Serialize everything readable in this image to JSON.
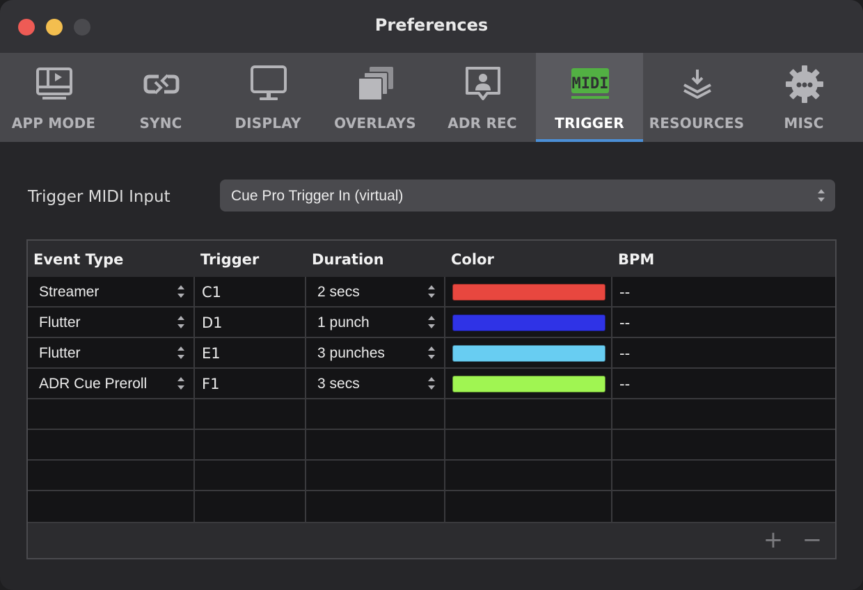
{
  "window": {
    "title": "Preferences"
  },
  "toolbar": {
    "tabs": [
      {
        "label": "APP MODE",
        "icon": "app-mode-icon",
        "active": false
      },
      {
        "label": "SYNC",
        "icon": "sync-icon",
        "active": false
      },
      {
        "label": "DISPLAY",
        "icon": "display-icon",
        "active": false
      },
      {
        "label": "OVERLAYS",
        "icon": "overlays-icon",
        "active": false
      },
      {
        "label": "ADR REC",
        "icon": "adr-rec-icon",
        "active": false
      },
      {
        "label": "TRIGGER",
        "icon": "midi-icon",
        "active": true
      },
      {
        "label": "RESOURCES",
        "icon": "resources-icon",
        "active": false
      },
      {
        "label": "MISC",
        "icon": "gear-icon",
        "active": false
      }
    ],
    "midi_icon_text": "MIDI"
  },
  "trigger_input": {
    "label": "Trigger MIDI Input",
    "value": "Cue Pro Trigger In (virtual)"
  },
  "table": {
    "columns": [
      "Event Type",
      "Trigger",
      "Duration",
      "Color",
      "BPM"
    ],
    "rows": [
      {
        "event_type": "Streamer",
        "trigger": "C1",
        "duration": "2 secs",
        "color": "#e8473f",
        "bpm": "--"
      },
      {
        "event_type": "Flutter",
        "trigger": "D1",
        "duration": "1 punch",
        "color": "#2f33e6",
        "bpm": "--"
      },
      {
        "event_type": "Flutter",
        "trigger": "E1",
        "duration": "3 punches",
        "color": "#68cdf2",
        "bpm": "--"
      },
      {
        "event_type": "ADR Cue Preroll",
        "trigger": "F1",
        "duration": "3 secs",
        "color": "#a0f552",
        "bpm": "--"
      }
    ],
    "empty_rows": 4,
    "footer": {
      "add_label": "+",
      "remove_label": "−"
    }
  },
  "colors": {
    "accent": "#4b8fd6",
    "midi_green": "#52b043"
  }
}
